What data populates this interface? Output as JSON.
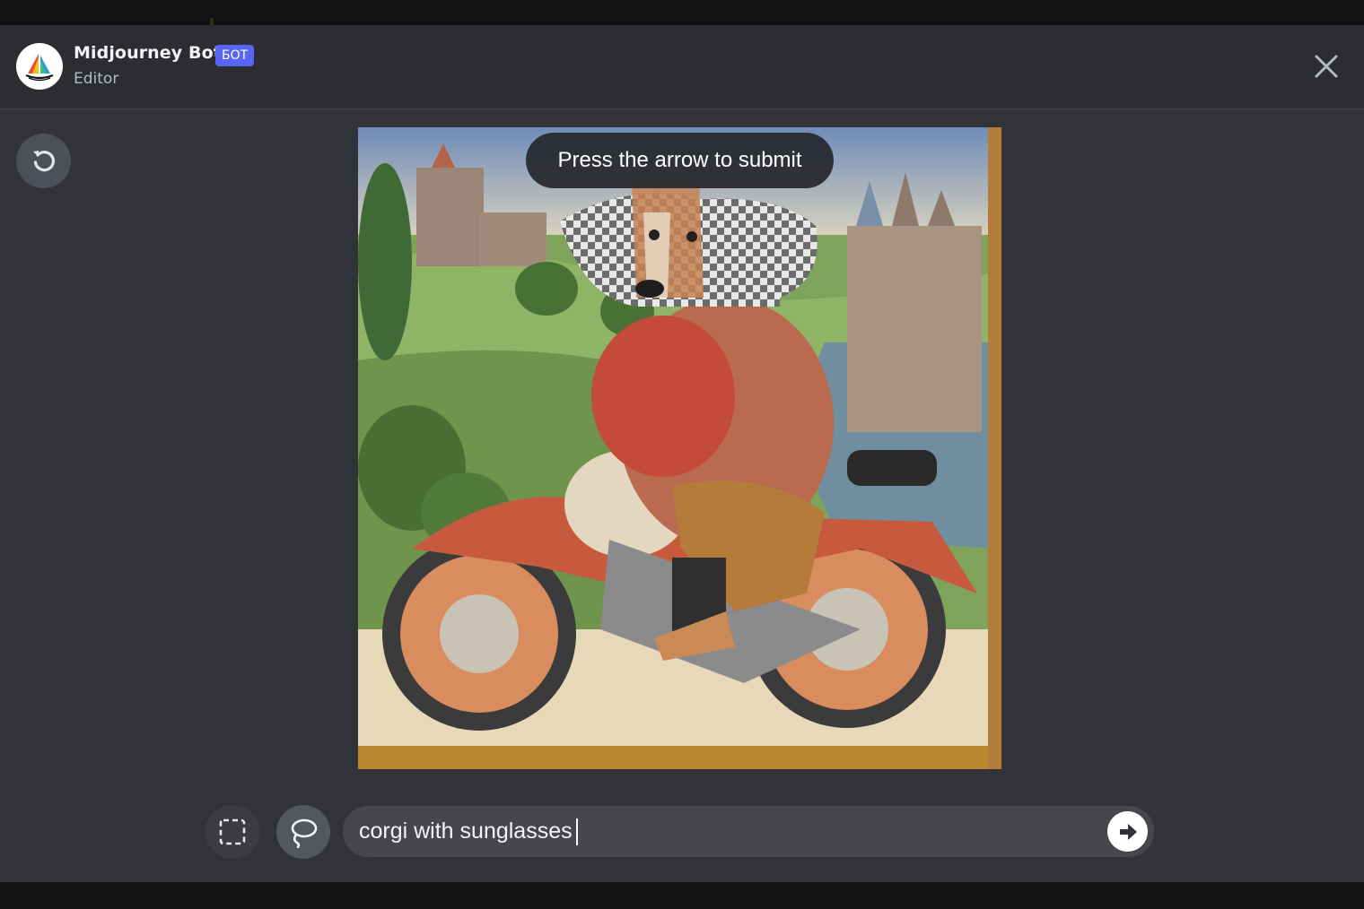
{
  "header": {
    "bot_name": "Midjourney Bot",
    "badge": "БОТ",
    "subtitle": "Editor"
  },
  "editor": {
    "hint": "Press the arrow to submit",
    "prompt_value": "corgi with sunglasses",
    "tools": [
      "rectangle-select",
      "lasso-select"
    ]
  },
  "icons": {
    "avatar": "midjourney-boat-icon",
    "close": "close-icon",
    "reset": "undo-icon",
    "rect": "dashed-rectangle-icon",
    "lasso": "lasso-icon",
    "submit": "arrow-right-icon"
  },
  "colors": {
    "modal_bg": "#313338",
    "header_bg": "#2b2d31",
    "badge": "#5865f2",
    "prompt_bg": "#45474d",
    "button_bg": "#4e5058"
  }
}
